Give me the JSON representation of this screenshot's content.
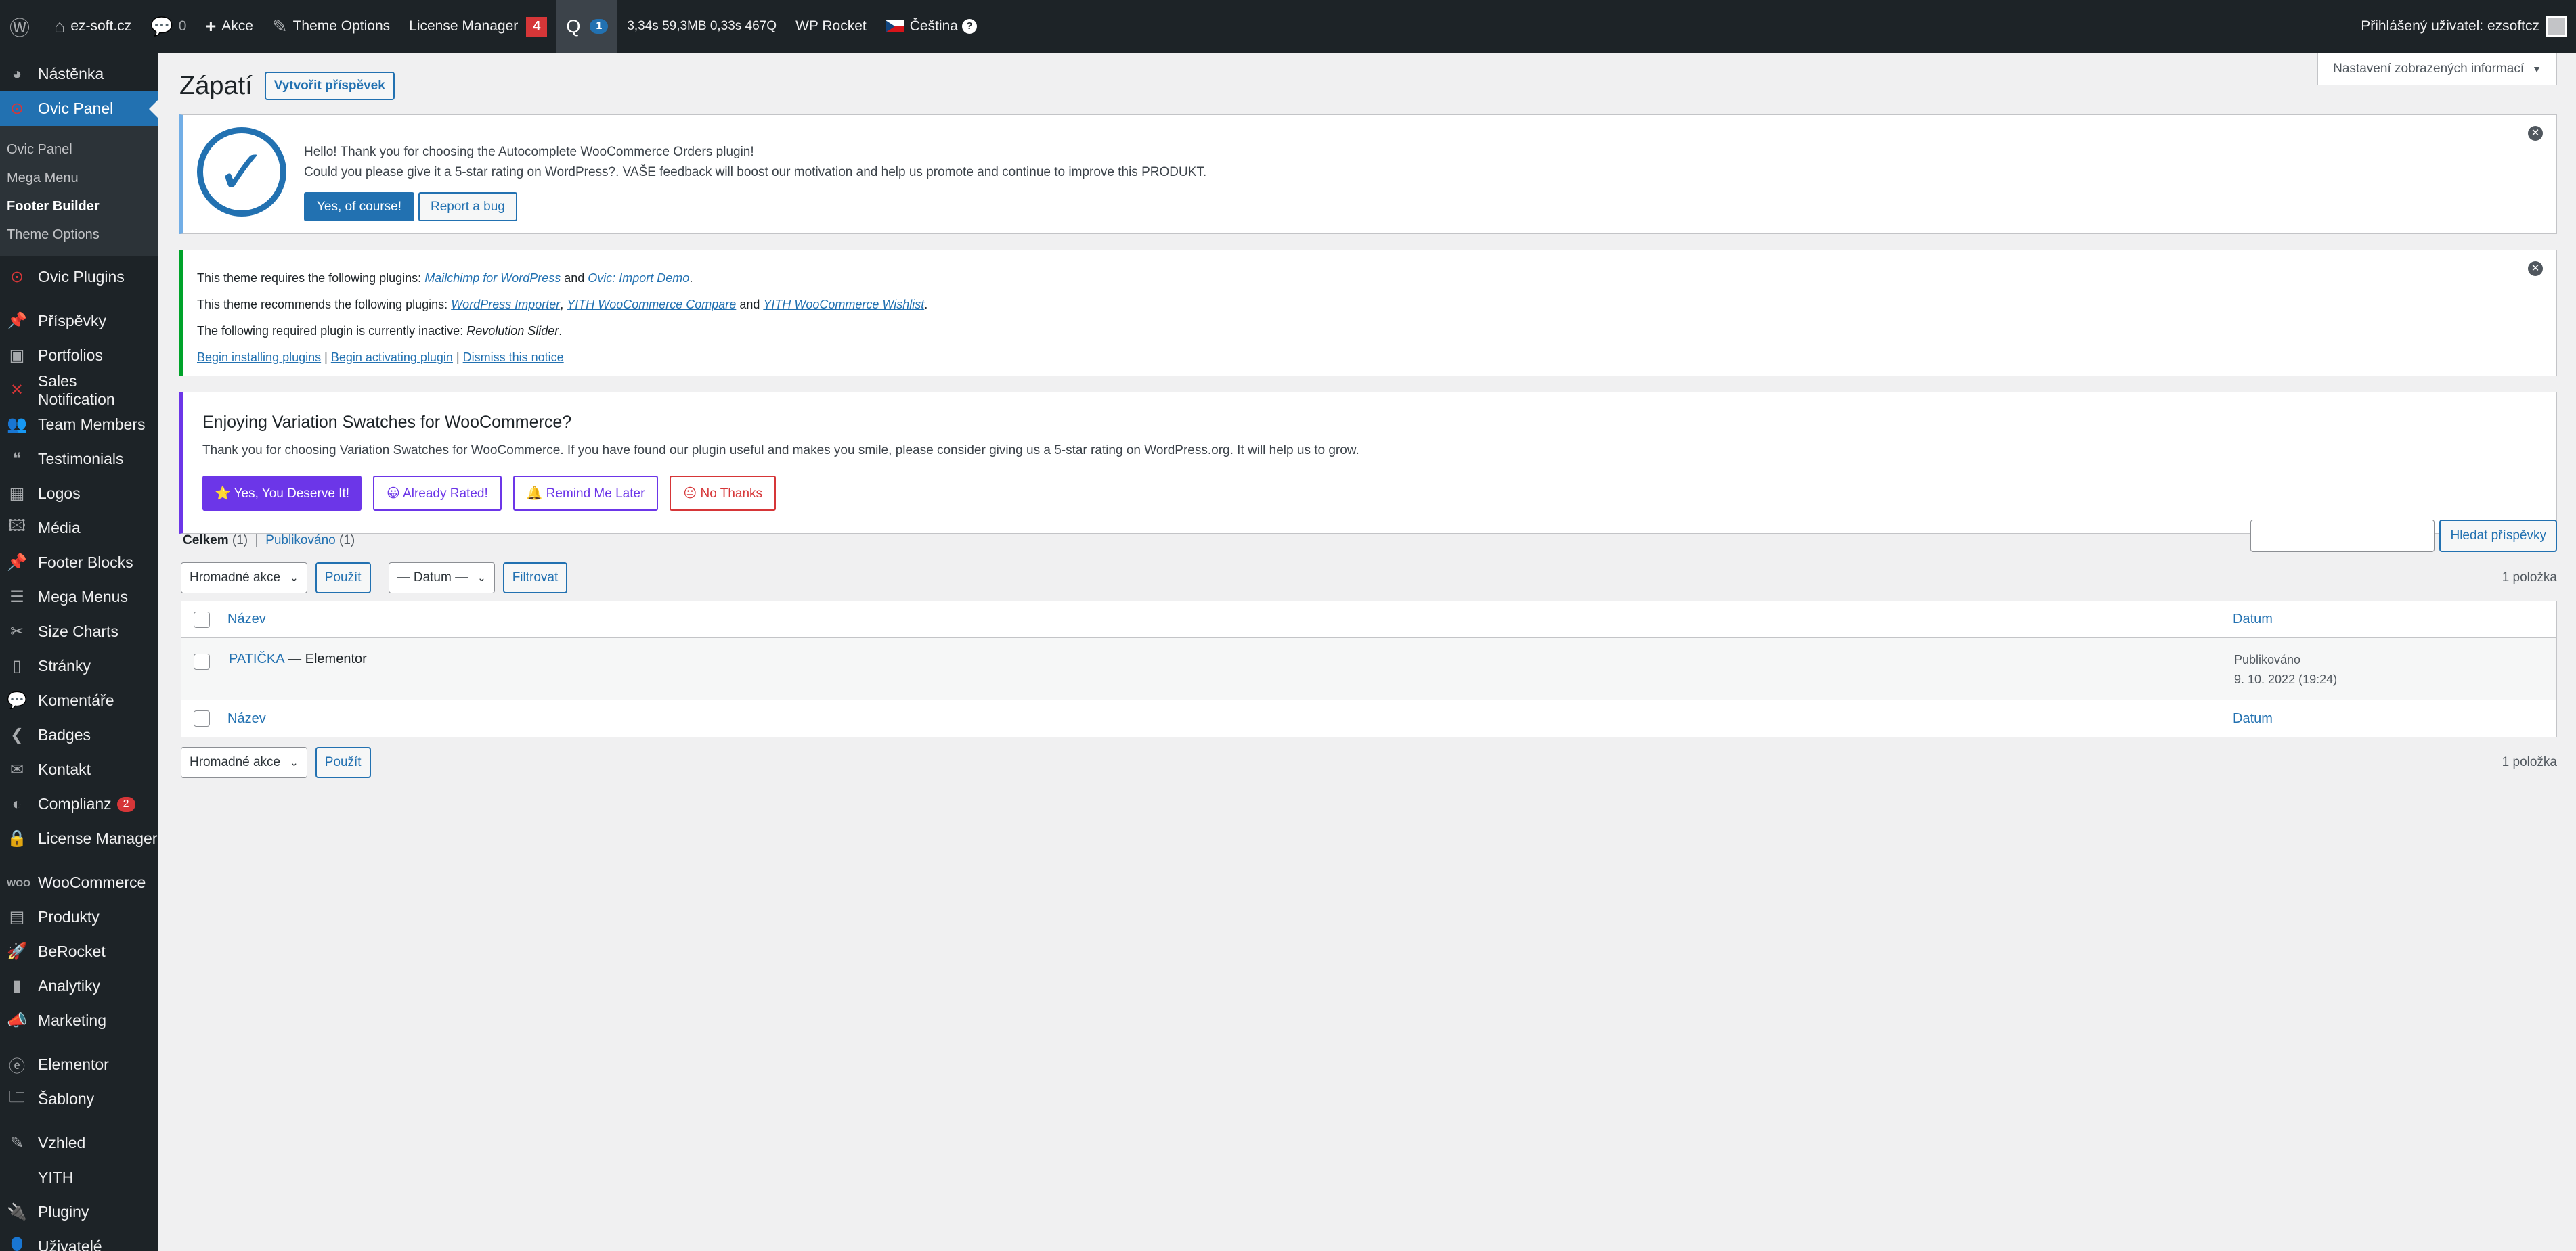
{
  "adminbar": {
    "site_name": "ez-soft.cz",
    "comments_count": "0",
    "new_label": "Akce",
    "theme_options": "Theme Options",
    "license_manager": "License Manager",
    "license_badge": "4",
    "qm_badge": "1",
    "qm_stats": "3,34s  59,3MB  0,33s  467Q",
    "wp_rocket": "WP Rocket",
    "language": "Čeština",
    "help": "?",
    "howdy": "Přihlášený uživatel: ezsoftcz"
  },
  "sidebar": {
    "top": [
      {
        "label": "Nástěnka",
        "icon": "dashboard-icon"
      },
      {
        "label": "Ovic Panel",
        "icon": "ovic-icon"
      }
    ],
    "submenu": [
      "Ovic Panel",
      "Mega Menu",
      "Footer Builder",
      "Theme Options"
    ],
    "items": [
      {
        "label": "Ovic Plugins"
      },
      {
        "label": "Příspěvky"
      },
      {
        "label": "Portfolios"
      },
      {
        "label": "Sales Notification"
      },
      {
        "label": "Team Members"
      },
      {
        "label": "Testimonials"
      },
      {
        "label": "Logos"
      },
      {
        "label": "Média"
      },
      {
        "label": "Footer Blocks"
      },
      {
        "label": "Mega Menus"
      },
      {
        "label": "Size Charts"
      },
      {
        "label": "Stránky"
      },
      {
        "label": "Komentáře"
      },
      {
        "label": "Badges"
      },
      {
        "label": "Kontakt"
      },
      {
        "label": "Complianz",
        "badge": "2"
      },
      {
        "label": "License Manager"
      },
      {
        "label": "WooCommerce"
      },
      {
        "label": "Produkty"
      },
      {
        "label": "BeRocket"
      },
      {
        "label": "Analytiky"
      },
      {
        "label": "Marketing"
      },
      {
        "label": "Elementor"
      },
      {
        "label": "Šablony"
      },
      {
        "label": "Vzhled"
      },
      {
        "label": "YITH"
      },
      {
        "label": "Pluginy"
      },
      {
        "label": "Uživatelé"
      }
    ]
  },
  "screen_options": "Nastavení zobrazených informací",
  "page": {
    "title": "Zápatí",
    "add_new": "Vytvořit příspěvek"
  },
  "notice_autocomplete": {
    "line1": "Hello! Thank you for choosing the Autocomplete WooCommerce Orders plugin!",
    "line2": "Could you please give it a 5-star rating on WordPress?. VAŠE feedback will boost our motivation and help us promote and continue to improve this PRODUKT.",
    "yes": "Yes, of course!",
    "bug": "Report a bug"
  },
  "notice_tgmpa": {
    "req_prefix": "This theme requires the following plugins: ",
    "req_plugin1": "Mailchimp for WordPress",
    "and": " and ",
    "req_plugin2": "Ovic: Import Demo",
    "dot": ".",
    "rec_prefix": "This theme recommends the following plugins: ",
    "rec_plugin1": "WordPress Importer",
    "comma": ", ",
    "rec_plugin2": "YITH WooCommerce Compare",
    "rec_plugin3": "YITH WooCommerce Wishlist",
    "inactive_prefix": "The following required plugin is currently inactive: ",
    "inactive_plugin": "Revolution Slider",
    "link_install": "Begin installing plugins",
    "sep": " | ",
    "link_activate": "Begin activating plugin",
    "link_dismiss": "Dismiss this notice"
  },
  "notice_swatches": {
    "title": "Enjoying Variation Swatches for WooCommerce?",
    "text": "Thank you for choosing Variation Swatches for WooCommerce. If you have found our plugin useful and makes you smile, please consider giving us a 5-star rating on WordPress.org. It will help us to grow.",
    "btn_yes": "⭐ Yes, You Deserve It!",
    "btn_rated": "😀 Already Rated!",
    "btn_later": "🔔 Remind Me Later",
    "btn_no": "😐 No Thanks"
  },
  "filters": {
    "all_label": "Celkem",
    "all_count": "(1)",
    "sep": "|",
    "published_label": "Publikováno",
    "published_count": "(1)",
    "search_button": "Hledat příspěvky",
    "bulk_actions": "Hromadné akce",
    "apply": "Použít",
    "date_filter": "— Datum —",
    "filter_button": "Filtrovat",
    "items_count": "1 položka"
  },
  "table": {
    "col_title": "Název",
    "col_date": "Datum",
    "rows": [
      {
        "title": "PATIČKA",
        "suffix": " — Elementor",
        "status": "Publikováno",
        "date": "9. 10. 2022 (19:24)"
      }
    ]
  }
}
